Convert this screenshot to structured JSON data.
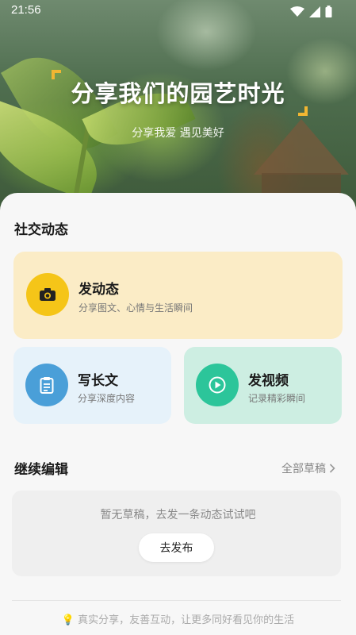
{
  "status_bar": {
    "time": "21:56"
  },
  "hero": {
    "title": "分享我们的园艺时光",
    "subtitle": "分享我爱 遇见美好",
    "accent_color": "#f2b632"
  },
  "social": {
    "section_title": "社交动态",
    "post_card": {
      "title": "发动态",
      "description": "分享图文、心情与生活瞬间",
      "icon": "camera-icon",
      "icon_color": "#f5c518",
      "bg": "#fbecc6"
    },
    "article_card": {
      "title": "写长文",
      "description": "分享深度内容",
      "icon": "document-icon",
      "icon_color": "#4a9fd8",
      "bg": "#e6f2fa"
    },
    "video_card": {
      "title": "发视频",
      "description": "记录精彩瞬间",
      "icon": "play-icon",
      "icon_color": "#2cc59a",
      "bg": "#cdeee2"
    }
  },
  "drafts": {
    "section_title": "继续编辑",
    "all_drafts_label": "全部草稿",
    "empty_text": "暂无草稿，去发一条动态试试吧",
    "publish_button": "去发布"
  },
  "footer": {
    "icon": "lightbulb-icon",
    "text": "真实分享，友善互动，让更多同好看见你的生活"
  }
}
